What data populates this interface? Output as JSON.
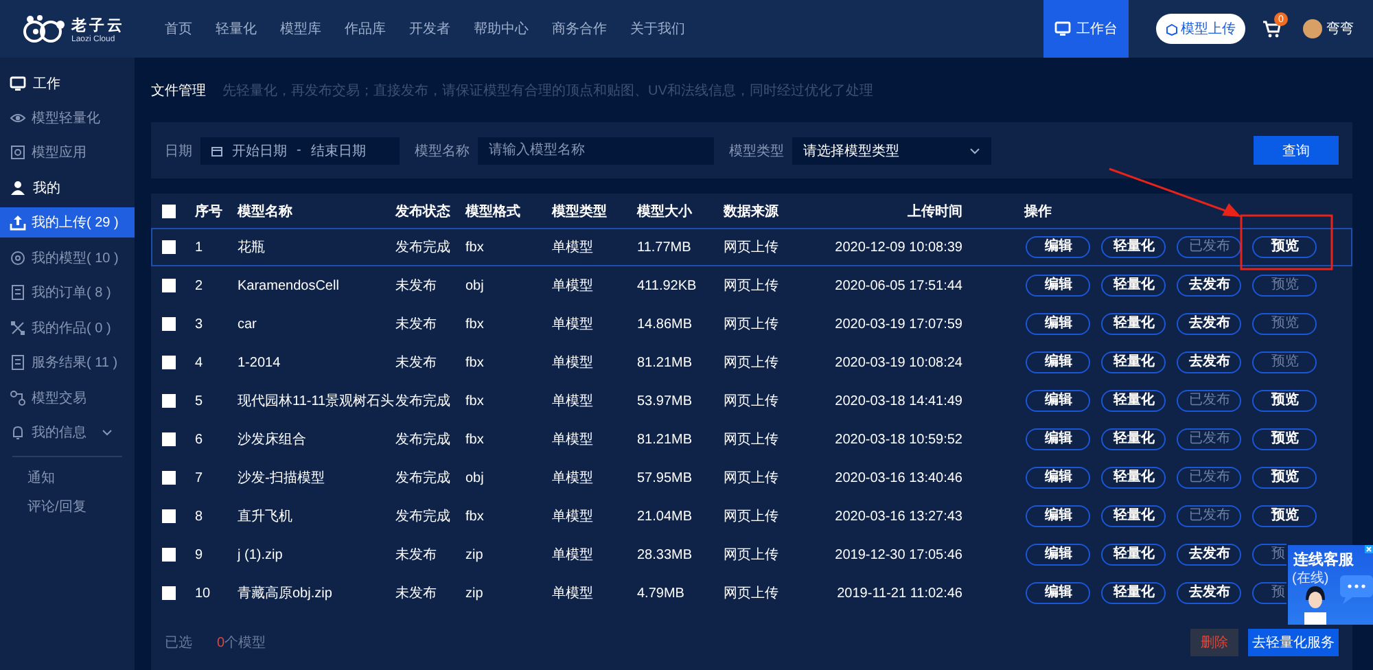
{
  "header": {
    "logo": {
      "name": "老子云",
      "subtitle": "Laozi Cloud"
    },
    "nav": [
      {
        "label": "首页",
        "selected": false
      },
      {
        "label": "轻量化",
        "selected": false
      },
      {
        "label": "模型库",
        "selected": false
      },
      {
        "label": "作品库",
        "selected": false
      },
      {
        "label": "开发者",
        "selected": false
      },
      {
        "label": "帮助中心",
        "selected": false
      },
      {
        "label": "商务合作",
        "selected": false
      },
      {
        "label": "关于我们",
        "selected": false
      }
    ],
    "workbench": {
      "label": "工作台",
      "selected": true
    },
    "upload_button": "模型上传",
    "cart_badge": "0",
    "user_name": "弯弯"
  },
  "sidebar": {
    "items": [
      {
        "kind": "section",
        "label": "工作"
      },
      {
        "kind": "item",
        "label": "模型轻量化",
        "selected": false
      },
      {
        "kind": "item",
        "label": "模型应用",
        "selected": false
      },
      {
        "kind": "section",
        "label": "我的"
      },
      {
        "kind": "item",
        "label": "我的上传( 29 )",
        "selected": true
      },
      {
        "kind": "item",
        "label": "我的模型( 10 )",
        "selected": false
      },
      {
        "kind": "item",
        "label": "我的订单( 8 )",
        "selected": false
      },
      {
        "kind": "item",
        "label": "我的作品( 0 )",
        "selected": false
      },
      {
        "kind": "item",
        "label": "服务结果( 11 )",
        "selected": false
      },
      {
        "kind": "item",
        "label": "模型交易",
        "selected": false
      },
      {
        "kind": "group",
        "label": "我的信息",
        "expanded": true,
        "children": [
          {
            "label": "通知",
            "selected": false
          },
          {
            "label": "评论/回复",
            "selected": false
          }
        ]
      }
    ]
  },
  "notice": {
    "title": "文件管理",
    "text": "先轻量化，再发布交易；直接发布，请保证模型有合理的顶点和贴图、UV和法线信息，同时经过优化了处理"
  },
  "filter": {
    "date_label": "日期",
    "start_placeholder": "开始日期",
    "separator": "-",
    "end_placeholder": "结束日期",
    "name_label": "模型名称",
    "name_placeholder": "请输入模型名称",
    "type_label": "模型类型",
    "type_placeholder": "请选择模型类型",
    "search_button": "查询"
  },
  "table": {
    "select_all_checked": false,
    "columns": [
      "序号",
      "模型名称",
      "发布状态",
      "模型格式",
      "模型类型",
      "模型大小",
      "数据来源",
      "上传时间",
      "操作"
    ],
    "rows": [
      {
        "checked": false,
        "highlighted": true,
        "cells": [
          "1",
          "花瓶",
          "发布完成",
          "fbx",
          "单模型",
          "11.77MB",
          "网页上传",
          "2020-12-09 10:08:39"
        ],
        "actions": [
          {
            "label": "编辑",
            "disabled": false
          },
          {
            "label": "轻量化",
            "disabled": false
          },
          {
            "label": "已发布",
            "disabled": true
          },
          {
            "label": "预览",
            "disabled": false
          }
        ]
      },
      {
        "checked": false,
        "highlighted": false,
        "cells": [
          "2",
          "KaramendosCell",
          "未发布",
          "obj",
          "单模型",
          "411.92KB",
          "网页上传",
          "2020-06-05 17:51:44"
        ],
        "actions": [
          {
            "label": "编辑",
            "disabled": false
          },
          {
            "label": "轻量化",
            "disabled": false
          },
          {
            "label": "去发布",
            "disabled": false
          },
          {
            "label": "预览",
            "disabled": true
          }
        ]
      },
      {
        "checked": false,
        "highlighted": false,
        "cells": [
          "3",
          "car",
          "未发布",
          "fbx",
          "单模型",
          "14.86MB",
          "网页上传",
          "2020-03-19 17:07:59"
        ],
        "actions": [
          {
            "label": "编辑",
            "disabled": false
          },
          {
            "label": "轻量化",
            "disabled": false
          },
          {
            "label": "去发布",
            "disabled": false
          },
          {
            "label": "预览",
            "disabled": true
          }
        ]
      },
      {
        "checked": false,
        "highlighted": false,
        "cells": [
          "4",
          "1-2014",
          "未发布",
          "fbx",
          "单模型",
          "81.21MB",
          "网页上传",
          "2020-03-19 10:08:24"
        ],
        "actions": [
          {
            "label": "编辑",
            "disabled": false
          },
          {
            "label": "轻量化",
            "disabled": false
          },
          {
            "label": "去发布",
            "disabled": false
          },
          {
            "label": "预览",
            "disabled": true
          }
        ]
      },
      {
        "checked": false,
        "highlighted": false,
        "cells": [
          "5",
          "现代园林11-11景观树石头",
          "发布完成",
          "fbx",
          "单模型",
          "53.97MB",
          "网页上传",
          "2020-03-18 14:41:49"
        ],
        "actions": [
          {
            "label": "编辑",
            "disabled": false
          },
          {
            "label": "轻量化",
            "disabled": false
          },
          {
            "label": "已发布",
            "disabled": true
          },
          {
            "label": "预览",
            "disabled": false
          }
        ]
      },
      {
        "checked": false,
        "highlighted": false,
        "cells": [
          "6",
          "沙发床组合",
          "发布完成",
          "fbx",
          "单模型",
          "81.21MB",
          "网页上传",
          "2020-03-18 10:59:52"
        ],
        "actions": [
          {
            "label": "编辑",
            "disabled": false
          },
          {
            "label": "轻量化",
            "disabled": false
          },
          {
            "label": "已发布",
            "disabled": true
          },
          {
            "label": "预览",
            "disabled": false
          }
        ]
      },
      {
        "checked": false,
        "highlighted": false,
        "cells": [
          "7",
          "沙发-扫描模型",
          "发布完成",
          "obj",
          "单模型",
          "57.95MB",
          "网页上传",
          "2020-03-16 13:40:46"
        ],
        "actions": [
          {
            "label": "编辑",
            "disabled": false
          },
          {
            "label": "轻量化",
            "disabled": false
          },
          {
            "label": "已发布",
            "disabled": true
          },
          {
            "label": "预览",
            "disabled": false
          }
        ]
      },
      {
        "checked": false,
        "highlighted": false,
        "cells": [
          "8",
          "直升飞机",
          "发布完成",
          "fbx",
          "单模型",
          "21.04MB",
          "网页上传",
          "2020-03-16 13:27:43"
        ],
        "actions": [
          {
            "label": "编辑",
            "disabled": false
          },
          {
            "label": "轻量化",
            "disabled": false
          },
          {
            "label": "已发布",
            "disabled": true
          },
          {
            "label": "预览",
            "disabled": false
          }
        ]
      },
      {
        "checked": false,
        "highlighted": false,
        "cells": [
          "9",
          "j (1).zip",
          "未发布",
          "zip",
          "单模型",
          "28.33MB",
          "网页上传",
          "2019-12-30 17:05:46"
        ],
        "actions": [
          {
            "label": "编辑",
            "disabled": false
          },
          {
            "label": "轻量化",
            "disabled": false
          },
          {
            "label": "去发布",
            "disabled": false
          },
          {
            "label": "预",
            "disabled": true
          }
        ]
      },
      {
        "checked": false,
        "highlighted": false,
        "cells": [
          "10",
          "青藏高原obj.zip",
          "未发布",
          "zip",
          "单模型",
          "4.79MB",
          "网页上传",
          "2019-11-21 11:02:46"
        ],
        "actions": [
          {
            "label": "编辑",
            "disabled": false
          },
          {
            "label": "轻量化",
            "disabled": false
          },
          {
            "label": "去发布",
            "disabled": false
          },
          {
            "label": "预",
            "disabled": true
          }
        ]
      }
    ]
  },
  "footer": {
    "selected_label": "已选",
    "selected_count": "0个模型",
    "delete_button": "删除",
    "service_button": "去轻量化服务"
  },
  "chat_widget": {
    "title": "连线客服",
    "status": "(在线)"
  }
}
